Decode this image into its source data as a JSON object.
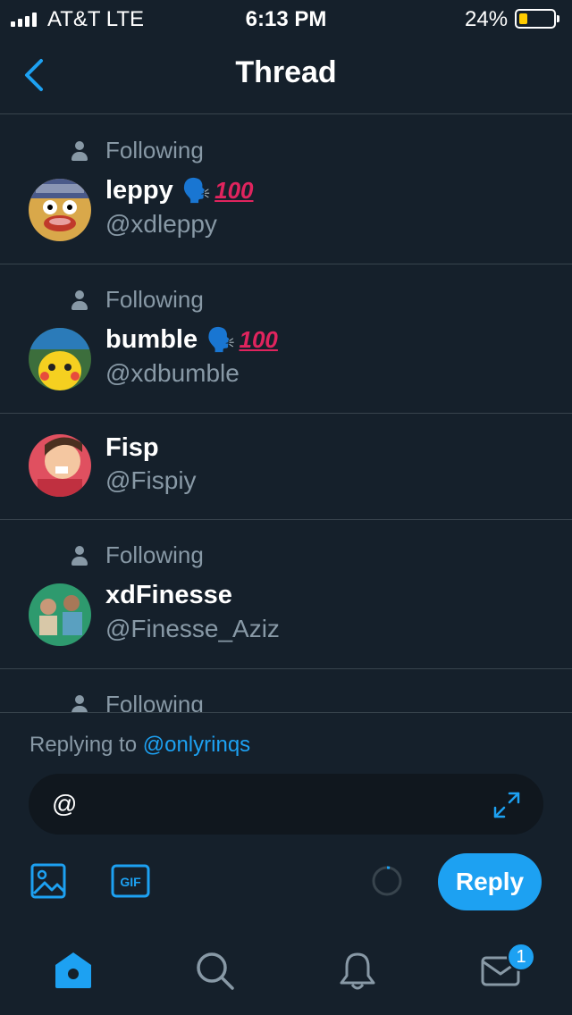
{
  "status_bar": {
    "carrier": "AT&T   LTE",
    "time": "6:13 PM",
    "battery_percent": "24%",
    "battery_level": 0.24,
    "signal_bars": 4
  },
  "nav": {
    "title": "Thread",
    "back_icon": "chevron-left-icon"
  },
  "users": [
    {
      "following_label": "Following",
      "name": "leppy",
      "emoji": "🗣️",
      "badge": "100",
      "handle": "@xdleppy"
    },
    {
      "following_label": "Following",
      "name": "bumble",
      "emoji": "🗣️",
      "badge": "100",
      "handle": "@xdbumble"
    },
    {
      "name": "Fisp",
      "handle": "@Fispiy"
    },
    {
      "following_label": "Following",
      "name": "xdFinesse",
      "handle": "@Finesse_Aziz"
    },
    {
      "following_label": "Following"
    }
  ],
  "composer": {
    "replying_prefix": "Replying to ",
    "replying_to": "@onlyrinqs",
    "input_value": "@",
    "reply_label": "Reply",
    "gif_label": "GIF"
  },
  "tabbar": {
    "tabs": [
      "home-icon",
      "search-icon",
      "notifications-icon",
      "messages-icon"
    ],
    "messages_badge": "1"
  },
  "colors": {
    "background": "#15202b",
    "accent": "#1da1f2",
    "secondary_text": "#8899a6",
    "divider": "#38444d"
  }
}
